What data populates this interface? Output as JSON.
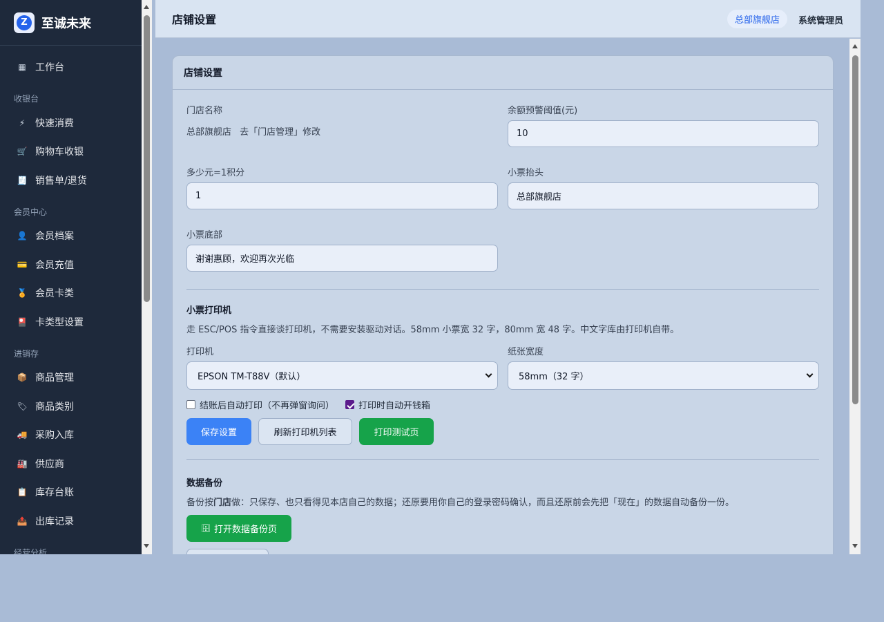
{
  "app": {
    "name": "至诚未来",
    "logo_letter": "Z"
  },
  "sidebar": {
    "groups": [
      {
        "items": [
          {
            "icon": "grid-icon",
            "glyph": "▦",
            "label": "工作台"
          }
        ]
      },
      {
        "title": "收银台",
        "items": [
          {
            "icon": "bolt-icon",
            "glyph": "⚡",
            "label": "快速消费"
          },
          {
            "icon": "cart-icon",
            "glyph": "🛒",
            "label": "购物车收银"
          },
          {
            "icon": "receipt-icon",
            "glyph": "🧾",
            "label": "销售单/退货"
          }
        ]
      },
      {
        "title": "会员中心",
        "items": [
          {
            "icon": "user-icon",
            "glyph": "👤",
            "label": "会员档案"
          },
          {
            "icon": "card-icon",
            "glyph": "💳",
            "label": "会员充值"
          },
          {
            "icon": "medal-icon",
            "glyph": "🏅",
            "label": "会员卡类"
          },
          {
            "icon": "card-settings-icon",
            "glyph": "🎴",
            "label": "卡类型设置"
          }
        ]
      },
      {
        "title": "进销存",
        "items": [
          {
            "icon": "box-icon",
            "glyph": "📦",
            "label": "商品管理"
          },
          {
            "icon": "tag-icon",
            "glyph": "🏷",
            "label": "商品类别"
          },
          {
            "icon": "truck-icon",
            "glyph": "🚚",
            "label": "采购入库"
          },
          {
            "icon": "factory-icon",
            "glyph": "🏭",
            "label": "供应商"
          },
          {
            "icon": "ledger-icon",
            "glyph": "📋",
            "label": "库存台账"
          },
          {
            "icon": "outbox-icon",
            "glyph": "📤",
            "label": "出库记录"
          }
        ]
      },
      {
        "title": "经营分析",
        "items": []
      }
    ]
  },
  "header": {
    "title": "店铺设置",
    "store": "总部旗舰店",
    "user": "系统管理员"
  },
  "card": {
    "title": "店铺设置",
    "store_name_label": "门店名称",
    "store_name_value": "总部旗舰店",
    "store_name_hint": "去「门店管理」修改",
    "balance_label": "余额预警阈值(元)",
    "balance_value": "10",
    "points_label": "多少元=1积分",
    "points_value": "1",
    "receipt_header_label": "小票抬头",
    "receipt_header_value": "总部旗舰店",
    "receipt_footer_label": "小票底部",
    "receipt_footer_value": "谢谢惠顾，欢迎再次光临",
    "printer_section": {
      "title": "小票打印机",
      "desc": "走 ESC/POS 指令直接谈打印机，不需要安装驱动对话。58mm 小票宽 32 字，80mm 宽 48 字。中文字库由打印机自带。",
      "printer_label": "打印机",
      "printer_value": "EPSON TM-T88V（默认）",
      "paper_label": "纸张宽度",
      "paper_value": "58mm（32 字）",
      "auto_print_label": "结账后自动打印（不再弹窗询问）",
      "auto_print_checked": false,
      "cash_drawer_label": "打印时自动开钱箱",
      "cash_drawer_checked": true,
      "save_btn": "保存设置",
      "refresh_btn": "刷新打印机列表",
      "test_btn": "打印测试页"
    },
    "backup_section": {
      "title": "数据备份",
      "desc_prefix": "备份按",
      "desc_bold": "门店",
      "desc_suffix": "做：只保存、也只看得见本店自己的数据；还原要用你自己的登录密码确认，而且还原前会先把「现在」的数据自动备份一份。",
      "open_btn": "打开数据备份页",
      "open_btn_glyph": "🗄"
    }
  },
  "colors": {
    "sidebar_bg": "#1e293b",
    "primary": "#3b82f6",
    "success": "#16a34a",
    "page_bg": "#a9bbd6"
  }
}
